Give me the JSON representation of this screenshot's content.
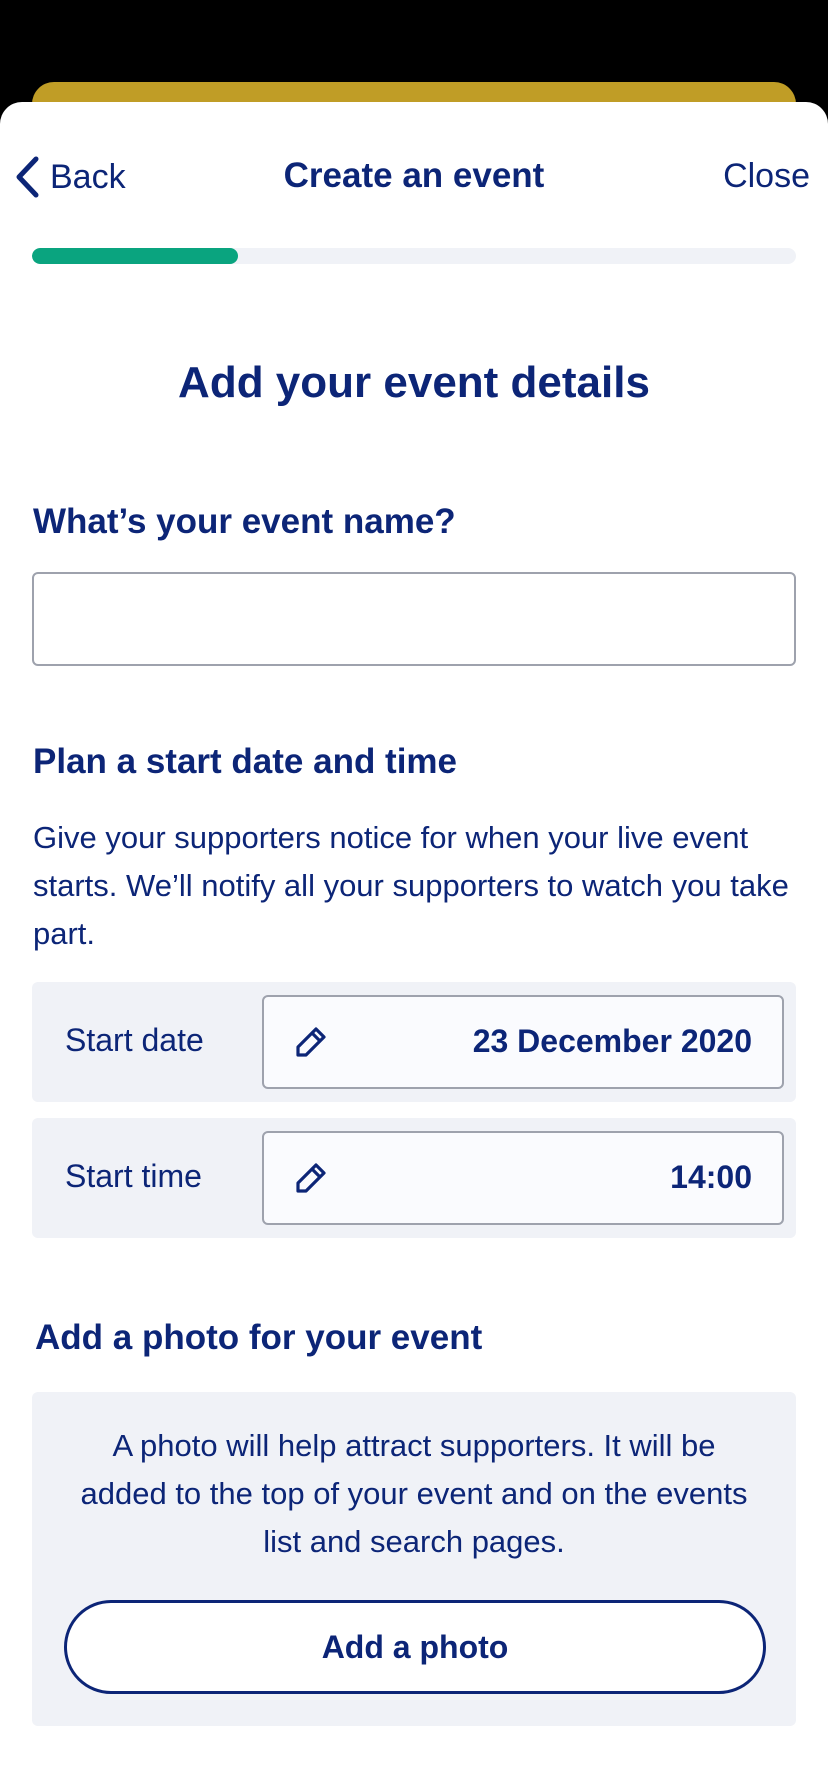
{
  "nav": {
    "back_label": "Back",
    "title": "Create an event",
    "close_label": "Close"
  },
  "progress": {
    "fraction": 0.27
  },
  "page": {
    "heading": "Add your event details"
  },
  "event_name": {
    "label": "What’s your event name?",
    "value": "",
    "placeholder": ""
  },
  "schedule": {
    "heading": "Plan a start date and time",
    "description": "Give your supporters notice for when your live event starts. We’ll notify all your supporters to watch you take part.",
    "start_date_label": "Start date",
    "start_date_value": "23 December 2020",
    "start_time_label": "Start time",
    "start_time_value": "14:00"
  },
  "photo": {
    "heading": "Add a photo for your event",
    "description": "A photo will help attract supporters. It will be added to the top of your event and on the events list and search pages.",
    "button_label": "Add a photo"
  },
  "icons": {
    "back": "chevron-left-icon",
    "edit": "pencil-icon"
  },
  "colors": {
    "primary": "#0c2577",
    "progress": "#0aa47f",
    "panel": "#f0f2f7",
    "accent": "#c09d26"
  }
}
